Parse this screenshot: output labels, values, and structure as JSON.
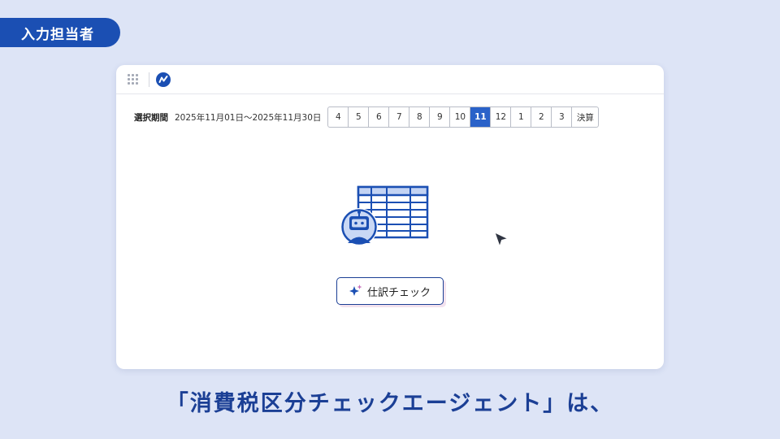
{
  "role_badge": "入力担当者",
  "toolbar": {
    "apps_icon": "grid-dots-icon",
    "logo_icon": "brand-logo-icon"
  },
  "period": {
    "label": "選択期間",
    "range": "2025年11月01日～2025年11月30日",
    "months": [
      {
        "label": "4"
      },
      {
        "label": "5"
      },
      {
        "label": "6"
      },
      {
        "label": "7"
      },
      {
        "label": "8"
      },
      {
        "label": "9"
      },
      {
        "label": "10"
      },
      {
        "label": "11"
      },
      {
        "label": "12"
      },
      {
        "label": "1"
      },
      {
        "label": "2"
      },
      {
        "label": "3"
      },
      {
        "label": "決算"
      }
    ],
    "selected_month": "11"
  },
  "illustration": {
    "icon": "spreadsheet-robot-icon"
  },
  "action_button": {
    "label": "仕訳チェック",
    "icon": "sparkle-icon"
  },
  "caption": "「消費税区分チェックエージェント」は、",
  "colors": {
    "background": "#dde4f6",
    "brand": "#1b4fb3",
    "active_month": "#2a62c9",
    "caption": "#1b3f95"
  }
}
